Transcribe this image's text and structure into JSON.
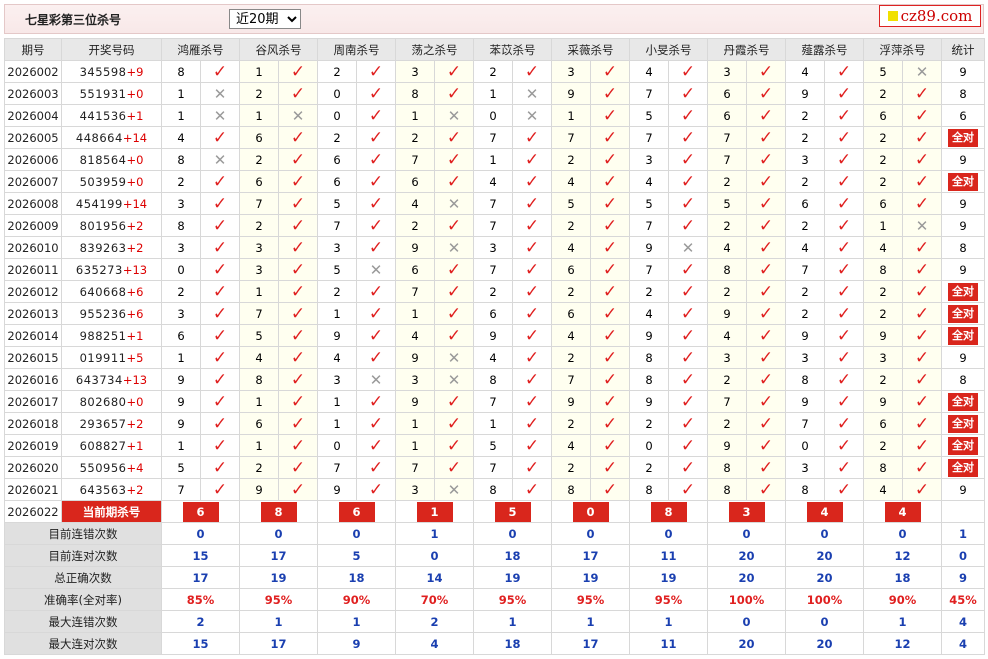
{
  "header": {
    "title": "七星彩第三位杀号",
    "period_selected": "近20期",
    "period_options": [
      "近20期"
    ],
    "logo_text": "cz89.com"
  },
  "columns": {
    "issue": "期号",
    "numbers": "开奖号码",
    "experts": [
      "鸿雁杀号",
      "谷风杀号",
      "周南杀号",
      "荡之杀号",
      "苯苡杀号",
      "采薇杀号",
      "小旻杀号",
      "丹霞杀号",
      "薤露杀号",
      "浮萍杀号"
    ],
    "count": "统计"
  },
  "rows": [
    {
      "issue": "2026002",
      "numbers": "345598",
      "plus": "+9",
      "kills": [
        8,
        1,
        2,
        3,
        2,
        3,
        4,
        3,
        4,
        5
      ],
      "ok": [
        1,
        1,
        1,
        1,
        1,
        1,
        1,
        1,
        1,
        0
      ],
      "count": "9"
    },
    {
      "issue": "2026003",
      "numbers": "551931",
      "plus": "+0",
      "kills": [
        1,
        2,
        0,
        8,
        1,
        9,
        7,
        6,
        9,
        2
      ],
      "ok": [
        0,
        1,
        1,
        1,
        0,
        1,
        1,
        1,
        1,
        1
      ],
      "count": "8"
    },
    {
      "issue": "2026004",
      "numbers": "441536",
      "plus": "+1",
      "kills": [
        1,
        1,
        0,
        1,
        0,
        1,
        5,
        6,
        2,
        6
      ],
      "ok": [
        0,
        0,
        1,
        0,
        0,
        1,
        1,
        1,
        1,
        1
      ],
      "count": "6"
    },
    {
      "issue": "2026005",
      "numbers": "448664",
      "plus": "+14",
      "kills": [
        4,
        6,
        2,
        2,
        7,
        7,
        7,
        7,
        2,
        2
      ],
      "ok": [
        1,
        1,
        1,
        1,
        1,
        1,
        1,
        1,
        1,
        1
      ],
      "count": "全对"
    },
    {
      "issue": "2026006",
      "numbers": "818564",
      "plus": "+0",
      "kills": [
        8,
        2,
        6,
        7,
        1,
        2,
        3,
        7,
        3,
        2
      ],
      "ok": [
        0,
        1,
        1,
        1,
        1,
        1,
        1,
        1,
        1,
        1
      ],
      "count": "9"
    },
    {
      "issue": "2026007",
      "numbers": "503959",
      "plus": "+0",
      "kills": [
        2,
        6,
        6,
        6,
        4,
        4,
        4,
        2,
        2,
        2
      ],
      "ok": [
        1,
        1,
        1,
        1,
        1,
        1,
        1,
        1,
        1,
        1
      ],
      "count": "全对"
    },
    {
      "issue": "2026008",
      "numbers": "454199",
      "plus": "+14",
      "kills": [
        3,
        7,
        5,
        4,
        7,
        5,
        5,
        5,
        6,
        6
      ],
      "ok": [
        1,
        1,
        1,
        0,
        1,
        1,
        1,
        1,
        1,
        1
      ],
      "count": "9"
    },
    {
      "issue": "2026009",
      "numbers": "801956",
      "plus": "+2",
      "kills": [
        8,
        2,
        7,
        2,
        7,
        2,
        7,
        2,
        2,
        1
      ],
      "ok": [
        1,
        1,
        1,
        1,
        1,
        1,
        1,
        1,
        1,
        0
      ],
      "count": "9"
    },
    {
      "issue": "2026010",
      "numbers": "839263",
      "plus": "+2",
      "kills": [
        3,
        3,
        3,
        9,
        3,
        4,
        9,
        4,
        4,
        4
      ],
      "ok": [
        1,
        1,
        1,
        0,
        1,
        1,
        0,
        1,
        1,
        1
      ],
      "count": "8"
    },
    {
      "issue": "2026011",
      "numbers": "635273",
      "plus": "+13",
      "kills": [
        0,
        3,
        5,
        6,
        7,
        6,
        7,
        8,
        7,
        8
      ],
      "ok": [
        1,
        1,
        0,
        1,
        1,
        1,
        1,
        1,
        1,
        1
      ],
      "count": "9"
    },
    {
      "issue": "2026012",
      "numbers": "640668",
      "plus": "+6",
      "kills": [
        2,
        1,
        2,
        7,
        2,
        2,
        2,
        2,
        2,
        2
      ],
      "ok": [
        1,
        1,
        1,
        1,
        1,
        1,
        1,
        1,
        1,
        1
      ],
      "count": "全对"
    },
    {
      "issue": "2026013",
      "numbers": "955236",
      "plus": "+6",
      "kills": [
        3,
        7,
        1,
        1,
        6,
        6,
        4,
        9,
        2,
        2
      ],
      "ok": [
        1,
        1,
        1,
        1,
        1,
        1,
        1,
        1,
        1,
        1
      ],
      "count": "全对"
    },
    {
      "issue": "2026014",
      "numbers": "988251",
      "plus": "+1",
      "kills": [
        6,
        5,
        9,
        4,
        9,
        4,
        9,
        4,
        9,
        9
      ],
      "ok": [
        1,
        1,
        1,
        1,
        1,
        1,
        1,
        1,
        1,
        1
      ],
      "count": "全对"
    },
    {
      "issue": "2026015",
      "numbers": "019911",
      "plus": "+5",
      "kills": [
        1,
        4,
        4,
        9,
        4,
        2,
        8,
        3,
        3,
        3
      ],
      "ok": [
        1,
        1,
        1,
        0,
        1,
        1,
        1,
        1,
        1,
        1
      ],
      "count": "9"
    },
    {
      "issue": "2026016",
      "numbers": "643734",
      "plus": "+13",
      "kills": [
        9,
        8,
        3,
        3,
        8,
        7,
        8,
        2,
        8,
        2
      ],
      "ok": [
        1,
        1,
        0,
        0,
        1,
        1,
        1,
        1,
        1,
        1
      ],
      "count": "8"
    },
    {
      "issue": "2026017",
      "numbers": "802680",
      "plus": "+0",
      "kills": [
        9,
        1,
        1,
        9,
        7,
        9,
        9,
        7,
        9,
        9
      ],
      "ok": [
        1,
        1,
        1,
        1,
        1,
        1,
        1,
        1,
        1,
        1
      ],
      "count": "全对"
    },
    {
      "issue": "2026018",
      "numbers": "293657",
      "plus": "+2",
      "kills": [
        9,
        6,
        1,
        1,
        1,
        2,
        2,
        2,
        7,
        6
      ],
      "ok": [
        1,
        1,
        1,
        1,
        1,
        1,
        1,
        1,
        1,
        1
      ],
      "count": "全对"
    },
    {
      "issue": "2026019",
      "numbers": "608827",
      "plus": "+1",
      "kills": [
        1,
        1,
        0,
        1,
        5,
        4,
        0,
        9,
        0,
        2
      ],
      "ok": [
        1,
        1,
        1,
        1,
        1,
        1,
        1,
        1,
        1,
        1
      ],
      "count": "全对"
    },
    {
      "issue": "2026020",
      "numbers": "550956",
      "plus": "+4",
      "kills": [
        5,
        2,
        7,
        7,
        7,
        2,
        2,
        8,
        3,
        8
      ],
      "ok": [
        1,
        1,
        1,
        1,
        1,
        1,
        1,
        1,
        1,
        1
      ],
      "count": "全对"
    },
    {
      "issue": "2026021",
      "numbers": "643563",
      "plus": "+2",
      "kills": [
        7,
        9,
        9,
        3,
        8,
        8,
        8,
        8,
        8,
        4
      ],
      "ok": [
        1,
        1,
        1,
        0,
        1,
        1,
        1,
        1,
        1,
        1
      ],
      "count": "9"
    }
  ],
  "current": {
    "issue": "2026022",
    "label": "当前期杀号",
    "kills": [
      "6",
      "8",
      "6",
      "1",
      "5",
      "0",
      "8",
      "3",
      "4",
      "4"
    ]
  },
  "stats": [
    {
      "label": "目前连错次数",
      "values": [
        "0",
        "0",
        "0",
        "1",
        "0",
        "0",
        "0",
        "0",
        "0",
        "0"
      ],
      "total": "1",
      "pct": false
    },
    {
      "label": "目前连对次数",
      "values": [
        "15",
        "17",
        "5",
        "0",
        "18",
        "17",
        "11",
        "20",
        "20",
        "12"
      ],
      "total": "0",
      "pct": false
    },
    {
      "label": "总正确次数",
      "values": [
        "17",
        "19",
        "18",
        "14",
        "19",
        "19",
        "19",
        "20",
        "20",
        "18"
      ],
      "total": "9",
      "pct": false
    },
    {
      "label": "准确率(全对率)",
      "values": [
        "85%",
        "95%",
        "90%",
        "70%",
        "95%",
        "95%",
        "95%",
        "100%",
        "100%",
        "90%"
      ],
      "total": "45%",
      "pct": true
    },
    {
      "label": "最大连错次数",
      "values": [
        "2",
        "1",
        "1",
        "2",
        "1",
        "1",
        "1",
        "0",
        "0",
        "1"
      ],
      "total": "4",
      "pct": false
    },
    {
      "label": "最大连对次数",
      "values": [
        "15",
        "17",
        "9",
        "4",
        "18",
        "17",
        "11",
        "20",
        "20",
        "12"
      ],
      "total": "4",
      "pct": false
    }
  ],
  "marks": {
    "check": "✓",
    "cross": "✕"
  },
  "icons": {
    "check": "check-icon",
    "cross": "cross-icon",
    "logo": "logo-square-icon"
  },
  "colors": {
    "accent_red": "#d9261c",
    "stat_blue": "#1a3fb0",
    "header_gray": "#e8e8e8"
  }
}
